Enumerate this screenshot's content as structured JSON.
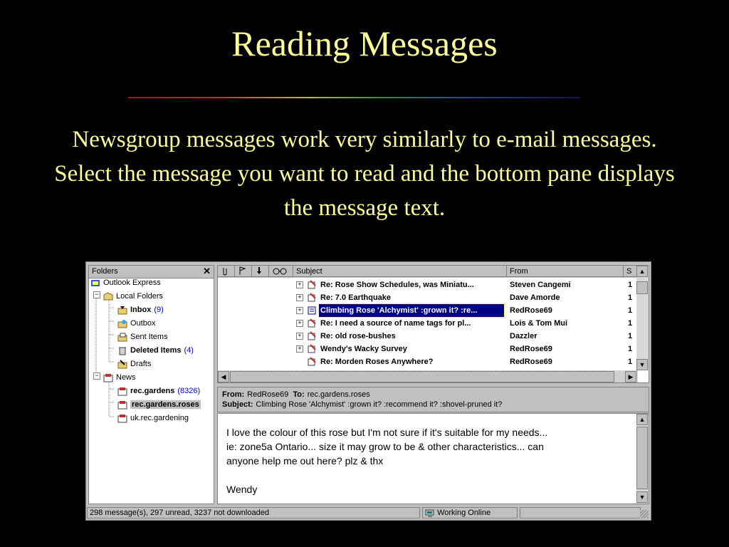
{
  "slide": {
    "title": "Reading Messages",
    "body": "Newsgroup messages work very similarly to e-mail messages. Select the message you want to read and the bottom pane displays the message text."
  },
  "folders_pane": {
    "header": "Folders",
    "close": "✕",
    "items": [
      {
        "label": "Outlook Express",
        "count": "",
        "icon": "outlook-express-icon"
      },
      {
        "label": "Local Folders",
        "count": "",
        "icon": "local-folders-icon"
      },
      {
        "label": "Inbox",
        "count": "(9)",
        "icon": "inbox-icon"
      },
      {
        "label": "Outbox",
        "count": "",
        "icon": "outbox-icon"
      },
      {
        "label": "Sent Items",
        "count": "",
        "icon": "sent-items-icon"
      },
      {
        "label": "Deleted Items",
        "count": "(4)",
        "icon": "deleted-items-icon"
      },
      {
        "label": "Drafts",
        "count": "",
        "icon": "drafts-icon"
      },
      {
        "label": "News",
        "count": "",
        "icon": "news-server-icon"
      },
      {
        "label": "rec.gardens",
        "count": "(8326)",
        "icon": "newsgroup-icon"
      },
      {
        "label": "rec.gardens.roses",
        "count": "",
        "icon": "newsgroup-icon"
      },
      {
        "label": "uk.rec.gardening",
        "count": "",
        "icon": "newsgroup-icon"
      }
    ]
  },
  "message_list": {
    "columns": {
      "subject": "Subject",
      "from": "From",
      "sent": "S"
    },
    "col_icons": [
      "paperclip-icon",
      "flag-icon",
      "download-arrow-icon",
      "watch-glasses-icon"
    ],
    "rows": [
      {
        "subject": "Re: Rose Show Schedules, was Miniatu...",
        "from": "Steven Cangemi",
        "sent": "1"
      },
      {
        "subject": "Re: 7.0 Earthquake",
        "from": "Dave Amorde",
        "sent": "1"
      },
      {
        "subject": "Climbing Rose 'Alchymist' :grown it? :re...",
        "from": "RedRose69",
        "sent": "1"
      },
      {
        "subject": "Re: I need a source of name tags for pl...",
        "from": "Lois & Tom Mui",
        "sent": "1"
      },
      {
        "subject": "Re: old rose-bushes",
        "from": "Dazzler",
        "sent": "1"
      },
      {
        "subject": "Wendy's Wacky Survey",
        "from": "RedRose69",
        "sent": "1"
      },
      {
        "subject": "Re: Morden Roses Anywhere?",
        "from": "RedRose69",
        "sent": "1"
      }
    ]
  },
  "preview_header": {
    "from_label": "From:",
    "from_value": "RedRose69",
    "to_label": "To:",
    "to_value": "rec.gardens.roses",
    "subject_label": "Subject:",
    "subject_value": "Climbing Rose 'Alchymist' :grown it? :recommend it? :shovel-pruned it?"
  },
  "preview_body": {
    "lines": [
      "I love the colour of this rose but I'm not sure if it's suitable for my needs...",
      "ie: zone5a Ontario... size it may grow to be & other characteristics... can",
      "anyone help me out here? plz & thx",
      "",
      "Wendy"
    ]
  },
  "status_bar": {
    "message": "298 message(s), 297 unread, 3237 not downloaded",
    "connection": "Working Online"
  }
}
